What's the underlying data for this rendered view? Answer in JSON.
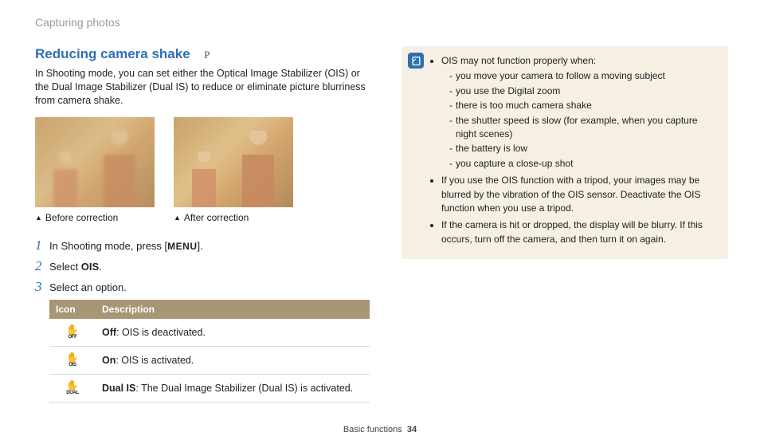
{
  "breadcrumb": "Capturing photos",
  "heading": "Reducing camera shake",
  "mode_tag": "P",
  "intro": "In Shooting mode, you can set either the Optical Image Stabilizer (OIS) or the Dual Image Stabilizer (Dual IS) to reduce or eliminate picture blurriness from camera shake.",
  "captions": {
    "before": "Before correction",
    "after": "After correction"
  },
  "steps": {
    "s1_pre": "In Shooting mode, press [",
    "s1_menu": "MENU",
    "s1_post": "].",
    "s2_pre": "Select ",
    "s2_bold": "OIS",
    "s2_post": ".",
    "s3": "Select an option."
  },
  "table": {
    "h_icon": "Icon",
    "h_desc": "Description",
    "rows": [
      {
        "icon_sub": "OFF",
        "label": "Off",
        "desc": ": OIS is deactivated."
      },
      {
        "icon_sub": "OIS",
        "label": "On",
        "desc": ": OIS is activated."
      },
      {
        "icon_sub": "DUAL",
        "label": "Dual IS",
        "desc": ": The Dual Image Stabilizer (Dual IS) is activated."
      }
    ]
  },
  "notes": {
    "b1": "OIS may not function properly when:",
    "b1_subs": [
      "you move your camera to follow a moving subject",
      "you use the Digital zoom",
      "there is too much camera shake",
      "the shutter speed is slow (for example, when you capture night scenes)",
      "the battery is low",
      "you capture a close-up shot"
    ],
    "b2": "If you use the OIS function with a tripod, your images may be blurred by the vibration of the OIS sensor. Deactivate the OIS function when you use a tripod.",
    "b3": "If the camera is hit or dropped, the display will be blurry. If this occurs, turn off the camera, and then turn it on again."
  },
  "footer": {
    "section": "Basic functions",
    "page": "34"
  }
}
